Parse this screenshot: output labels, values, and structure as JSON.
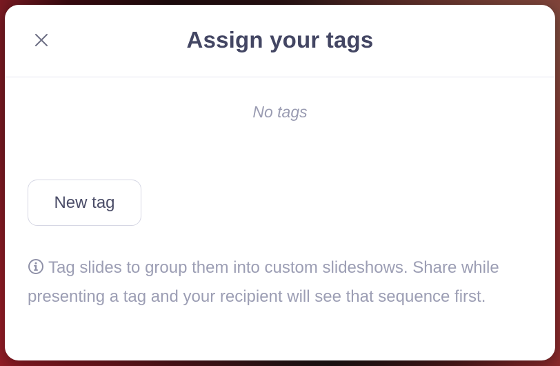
{
  "dialog": {
    "title": "Assign your tags",
    "close_icon": "close-icon",
    "empty_text": "No tags",
    "new_tag_label": "New tag",
    "info_icon": "info-circle-icon",
    "info_text": "Tag slides to group them into custom slideshows. Share while presenting a tag and your recipient will see that sequence first."
  },
  "colors": {
    "title": "#434663",
    "muted_text": "#9a9cb2",
    "button_border": "#d6d7e4",
    "divider": "#e3e3ee"
  }
}
